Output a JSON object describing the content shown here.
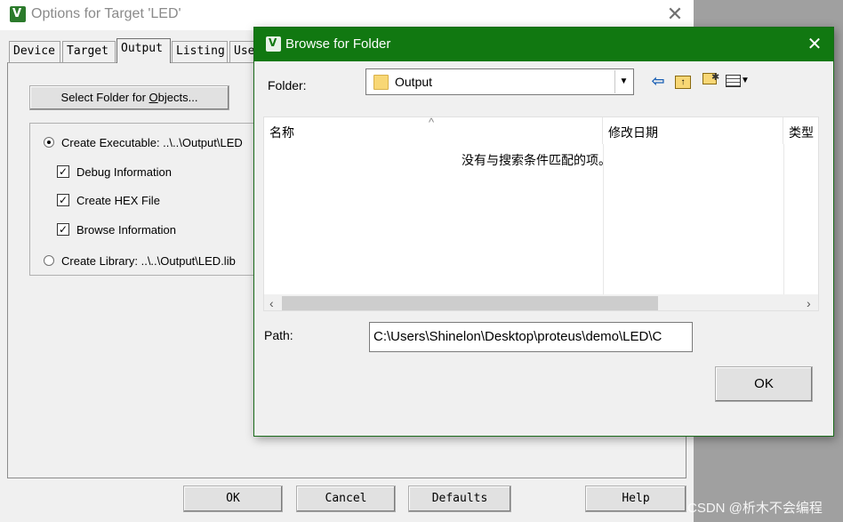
{
  "back_dialog": {
    "title": "Options for Target 'LED'",
    "close_label": "✕",
    "tabs": [
      {
        "label": "Device"
      },
      {
        "label": "Target"
      },
      {
        "label": "Output"
      },
      {
        "label": "Listing"
      },
      {
        "label": "Use"
      }
    ],
    "select_folder_prefix": "Select Folder for ",
    "select_folder_underlined": "O",
    "select_folder_suffix": "bjects...",
    "create_executable_label": "Create Executable:  ..\\..\\Output\\LED",
    "debug_information_label": "Debug Information",
    "create_hex_label": "Create HEX File",
    "browse_information_label": "Browse Information",
    "create_library_label": "Create Library:  ..\\..\\Output\\LED.lib",
    "create_executable_checked": true,
    "debug_information_checked": true,
    "create_hex_checked": true,
    "browse_information_checked": true,
    "create_library_checked": false,
    "buttons": {
      "ok": "OK",
      "cancel": "Cancel",
      "defaults": "Defaults",
      "help": "Help"
    }
  },
  "browse_dialog": {
    "title": "Browse for Folder",
    "close_label": "✕",
    "folder_label": "Folder:",
    "folder_value": "Output",
    "columns": {
      "name": "名称",
      "date": "修改日期",
      "type": "类型"
    },
    "empty_message": "没有与搜索条件匹配的项。",
    "path_label": "Path:",
    "path_value": "C:\\Users\\Shinelon\\Desktop\\proteus\\demo\\LED\\C",
    "ok_label": "OK"
  },
  "watermark": "CSDN @析木不会编程",
  "colors": {
    "browse_titlebar": "#117811",
    "dialog_bg": "#f0f0f0",
    "desktop_bg": "#a0a0a0"
  },
  "icons": {
    "app": "keil-uvision-icon",
    "folder": "folder-icon",
    "back": "back-arrow-icon",
    "up": "up-folder-icon",
    "new_folder": "new-folder-icon",
    "view": "view-menu-icon"
  }
}
